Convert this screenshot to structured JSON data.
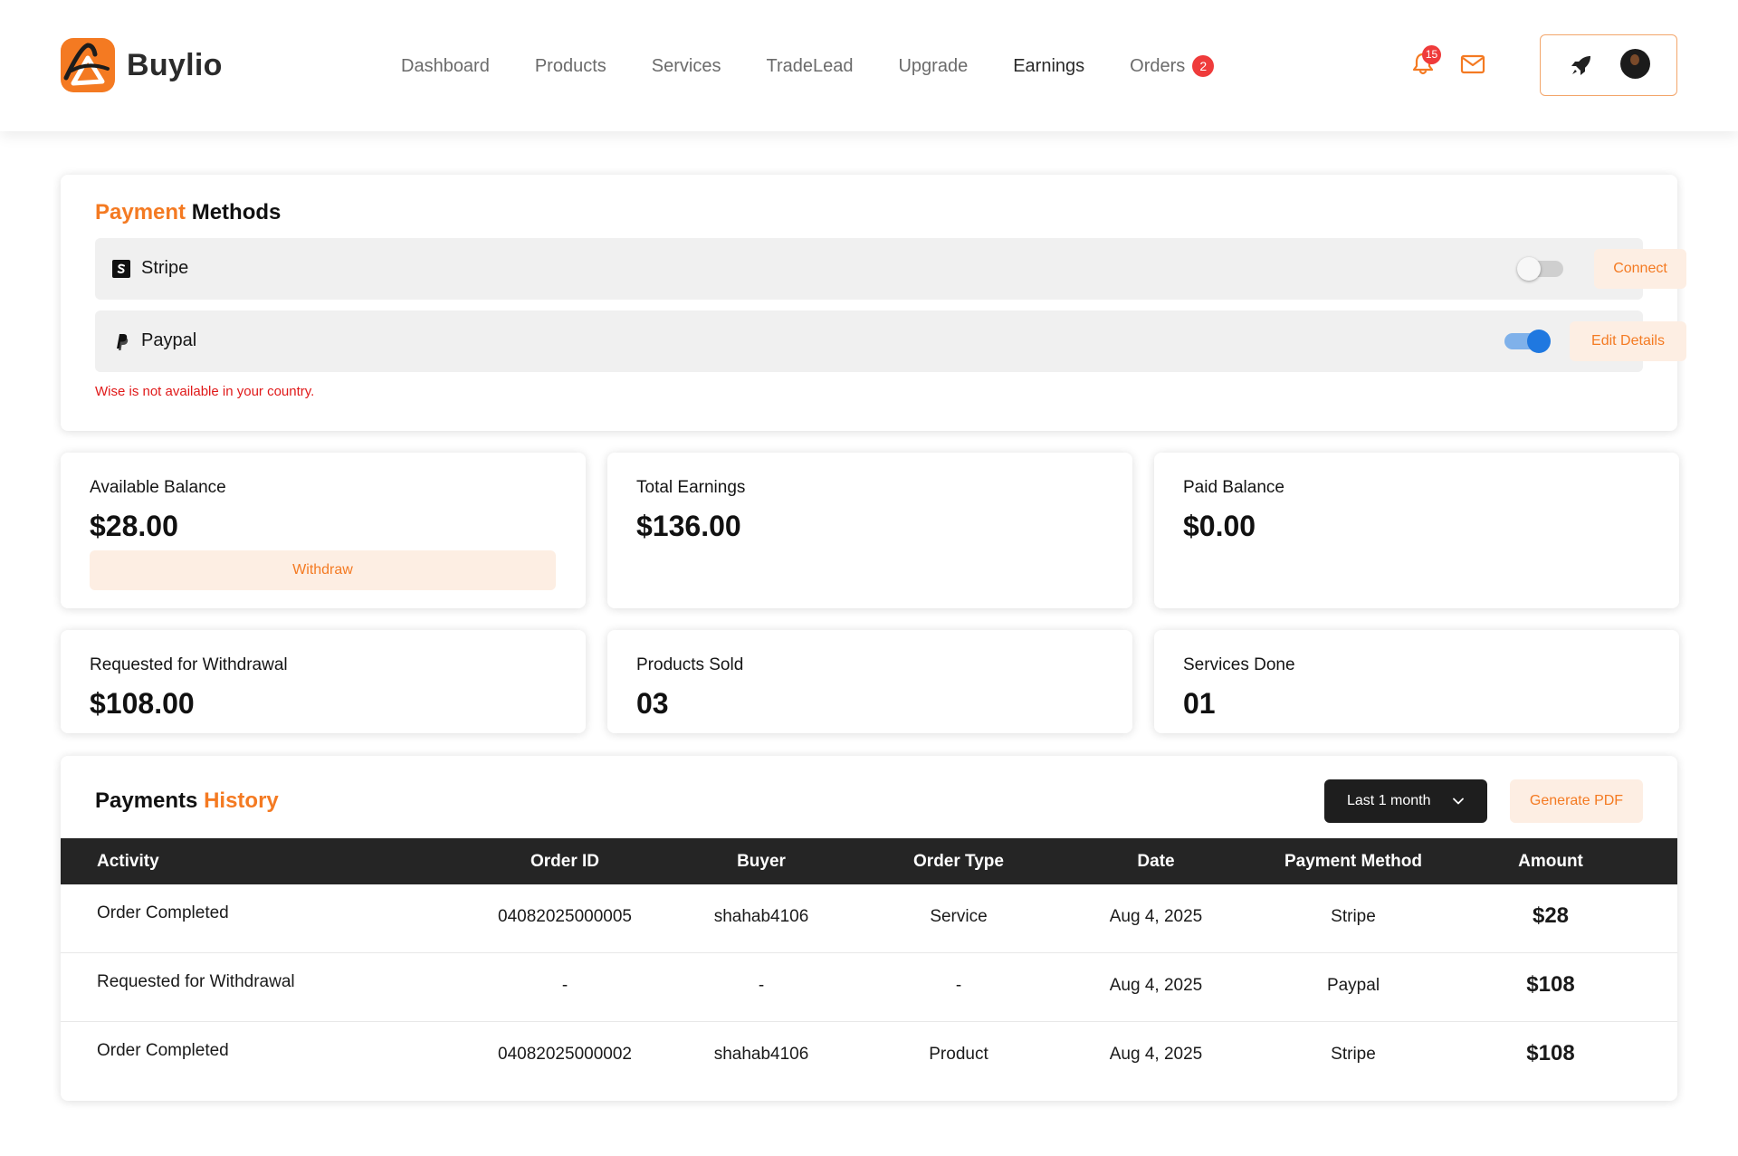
{
  "brand": {
    "name": "Buylio",
    "accent": "#f47a22"
  },
  "nav": {
    "items": [
      {
        "label": "Dashboard"
      },
      {
        "label": "Products"
      },
      {
        "label": "Services"
      },
      {
        "label": "TradeLead"
      },
      {
        "label": "Upgrade"
      },
      {
        "label": "Earnings",
        "active": true
      },
      {
        "label": "Orders",
        "badge": "2"
      }
    ]
  },
  "header": {
    "notifications_count": "15",
    "icons": [
      "bell-icon",
      "mail-icon",
      "rocket-icon",
      "avatar"
    ]
  },
  "payment_methods": {
    "title_accent": "Payment",
    "title_rest": "Methods",
    "methods": [
      {
        "name": "Stripe",
        "enabled": false,
        "button": "Connect"
      },
      {
        "name": "Paypal",
        "enabled": true,
        "button": "Edit Details"
      }
    ],
    "note": "Wise is not available in your country."
  },
  "stats": [
    {
      "label": "Available Balance",
      "value": "$28.00",
      "action": "Withdraw"
    },
    {
      "label": "Total Earnings",
      "value": "$136.00"
    },
    {
      "label": "Paid Balance",
      "value": "$0.00"
    },
    {
      "label": "Requested for Withdrawal",
      "value": "$108.00"
    },
    {
      "label": "Products Sold",
      "value": "03"
    },
    {
      "label": "Services Done",
      "value": "01"
    }
  ],
  "history": {
    "title_rest": "Payments",
    "title_accent": "History",
    "period": "Last 1 month",
    "pdf_button": "Generate PDF",
    "columns": [
      "Activity",
      "Order ID",
      "Buyer",
      "Order Type",
      "Date",
      "Payment Method",
      "Amount"
    ],
    "rows": [
      {
        "activity": "Order Completed",
        "order_id": "04082025000005",
        "buyer": "shahab4106",
        "type": "Service",
        "date": "Aug 4, 2025",
        "method": "Stripe",
        "amount": "$28"
      },
      {
        "activity": "Requested for Withdrawal",
        "order_id": "-",
        "buyer": "-",
        "type": "-",
        "date": "Aug 4, 2025",
        "method": "Paypal",
        "amount": "$108"
      },
      {
        "activity": "Order Completed",
        "order_id": "04082025000002",
        "buyer": "shahab4106",
        "type": "Product",
        "date": "Aug 4, 2025",
        "method": "Stripe",
        "amount": "$108"
      }
    ]
  }
}
